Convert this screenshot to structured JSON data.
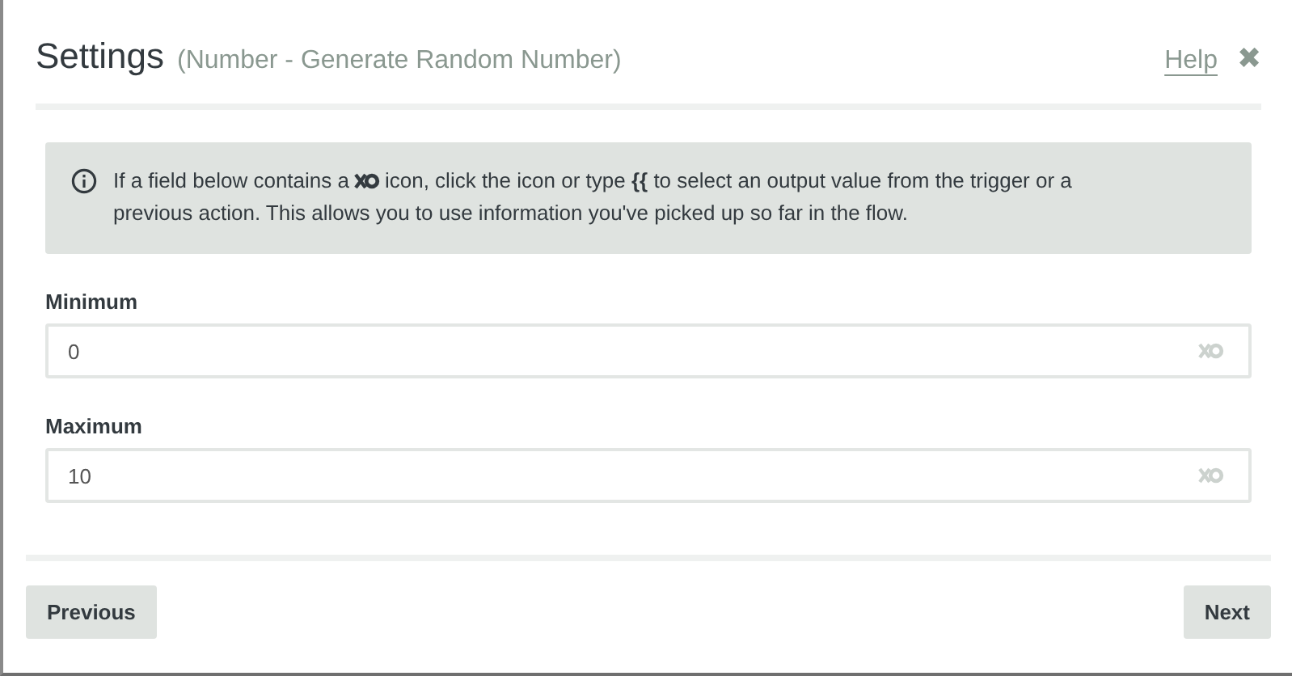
{
  "header": {
    "title": "Settings",
    "subtitle": "(Number - Generate Random Number)",
    "help": "Help",
    "close": "✖"
  },
  "info": {
    "before": "If a field below contains a",
    "after": "icon, click the icon or type **{{** to select an output value from the trigger or a",
    "continued": "previous action. This allows you to use information you've picked up so far in the flow."
  },
  "fields": [
    {
      "label": "Minimum",
      "value": "0"
    },
    {
      "label": "Maximum",
      "value": "10"
    }
  ],
  "footer": {
    "previous": "Previous",
    "next": "Next"
  }
}
